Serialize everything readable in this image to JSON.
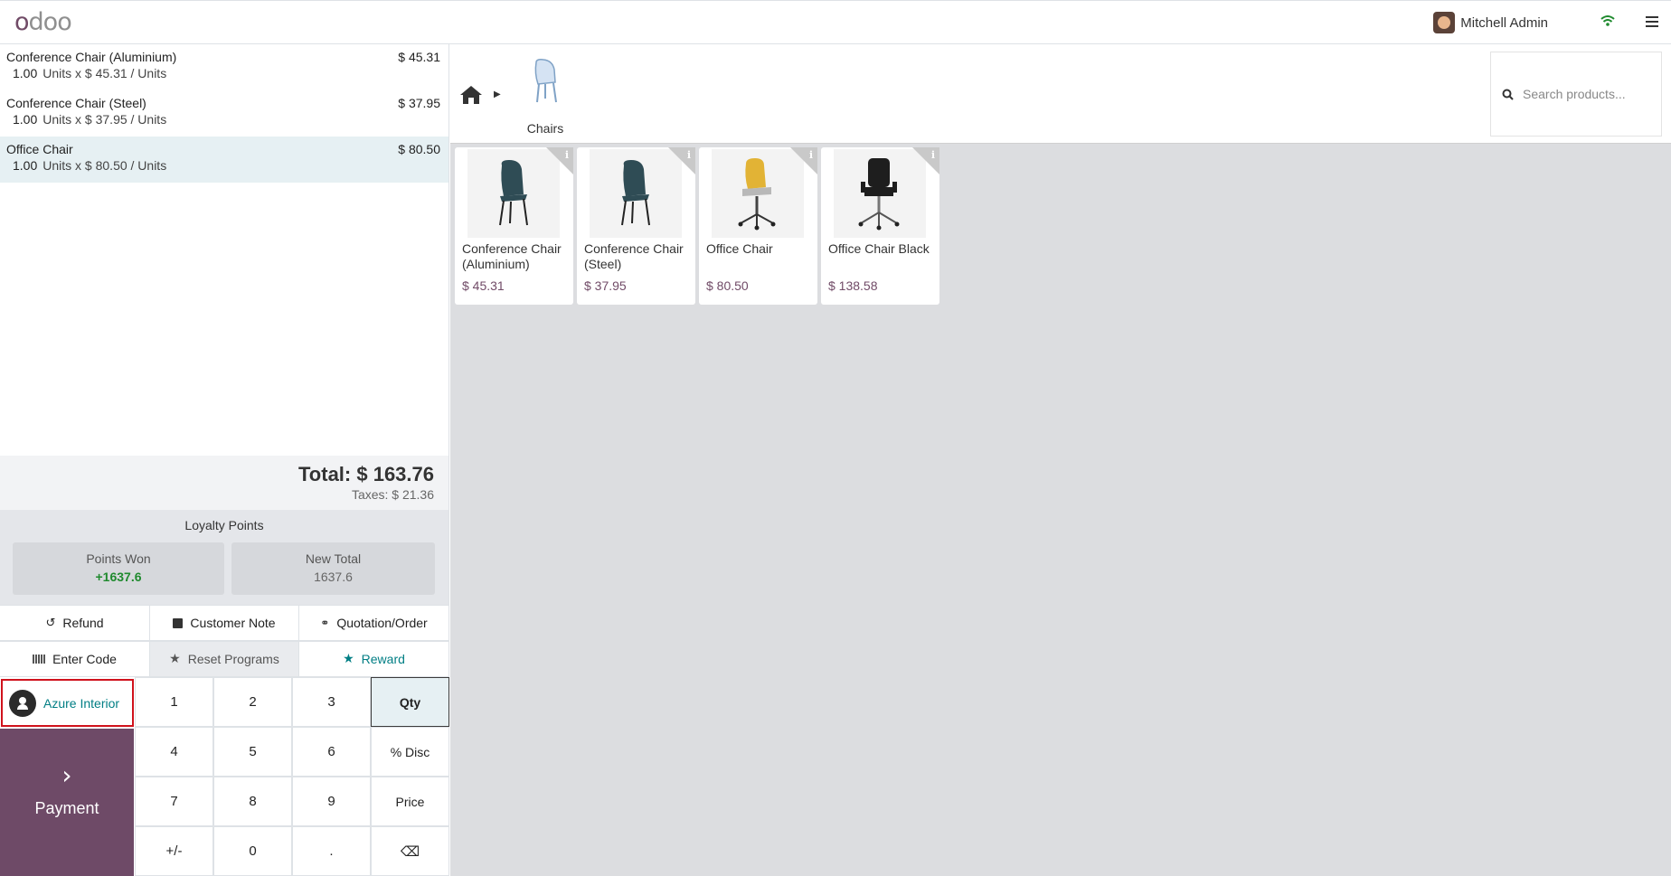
{
  "app": {
    "logo": "odoo"
  },
  "topbar": {
    "user_name": "Mitchell Admin"
  },
  "order": {
    "lines": [
      {
        "name": "Conference Chair (Aluminium)",
        "price": "$ 45.31",
        "qty": "1.00",
        "unit_detail": "Units x $ 45.31 / Units"
      },
      {
        "name": "Conference Chair (Steel)",
        "price": "$ 37.95",
        "qty": "1.00",
        "unit_detail": "Units x $ 37.95 / Units"
      },
      {
        "name": "Office Chair",
        "price": "$ 80.50",
        "qty": "1.00",
        "unit_detail": "Units x $ 80.50 / Units"
      }
    ],
    "total": "Total: $ 163.76",
    "taxes": "Taxes: $ 21.36"
  },
  "loyalty": {
    "title": "Loyalty Points",
    "points_won_label": "Points Won",
    "points_won_value": "+1637.6",
    "new_total_label": "New Total",
    "new_total_value": "1637.6"
  },
  "controls": {
    "refund": "Refund",
    "customer_note": "Customer Note",
    "quotation_order": "Quotation/Order",
    "enter_code": "Enter Code",
    "reset_programs": "Reset Programs",
    "reward": "Reward"
  },
  "customer": {
    "name": "Azure Interior"
  },
  "payment": {
    "label": "Payment"
  },
  "numpad": {
    "k1": "1",
    "k2": "2",
    "k3": "3",
    "qty": "Qty",
    "k4": "4",
    "k5": "5",
    "k6": "6",
    "disc": "% Disc",
    "k7": "7",
    "k8": "8",
    "k9": "9",
    "price": "Price",
    "plusminus": "+/-",
    "k0": "0",
    "dot": ".",
    "backspace": "⌫"
  },
  "products_header": {
    "category": "Chairs",
    "search_placeholder": "Search products..."
  },
  "products": [
    {
      "name": "Conference Chair (Aluminium)",
      "price": "$ 45.31",
      "color": "#2f4c55"
    },
    {
      "name": "Conference Chair (Steel)",
      "price": "$ 37.95",
      "color": "#2f4c55"
    },
    {
      "name": "Office Chair",
      "price": "$ 80.50",
      "color": "#e2b335"
    },
    {
      "name": "Office Chair Black",
      "price": "$ 138.58",
      "color": "#1e1e1e"
    }
  ],
  "colors": {
    "brand": "#714b67",
    "teal": "#017e84",
    "highlight": "#d0121c"
  }
}
